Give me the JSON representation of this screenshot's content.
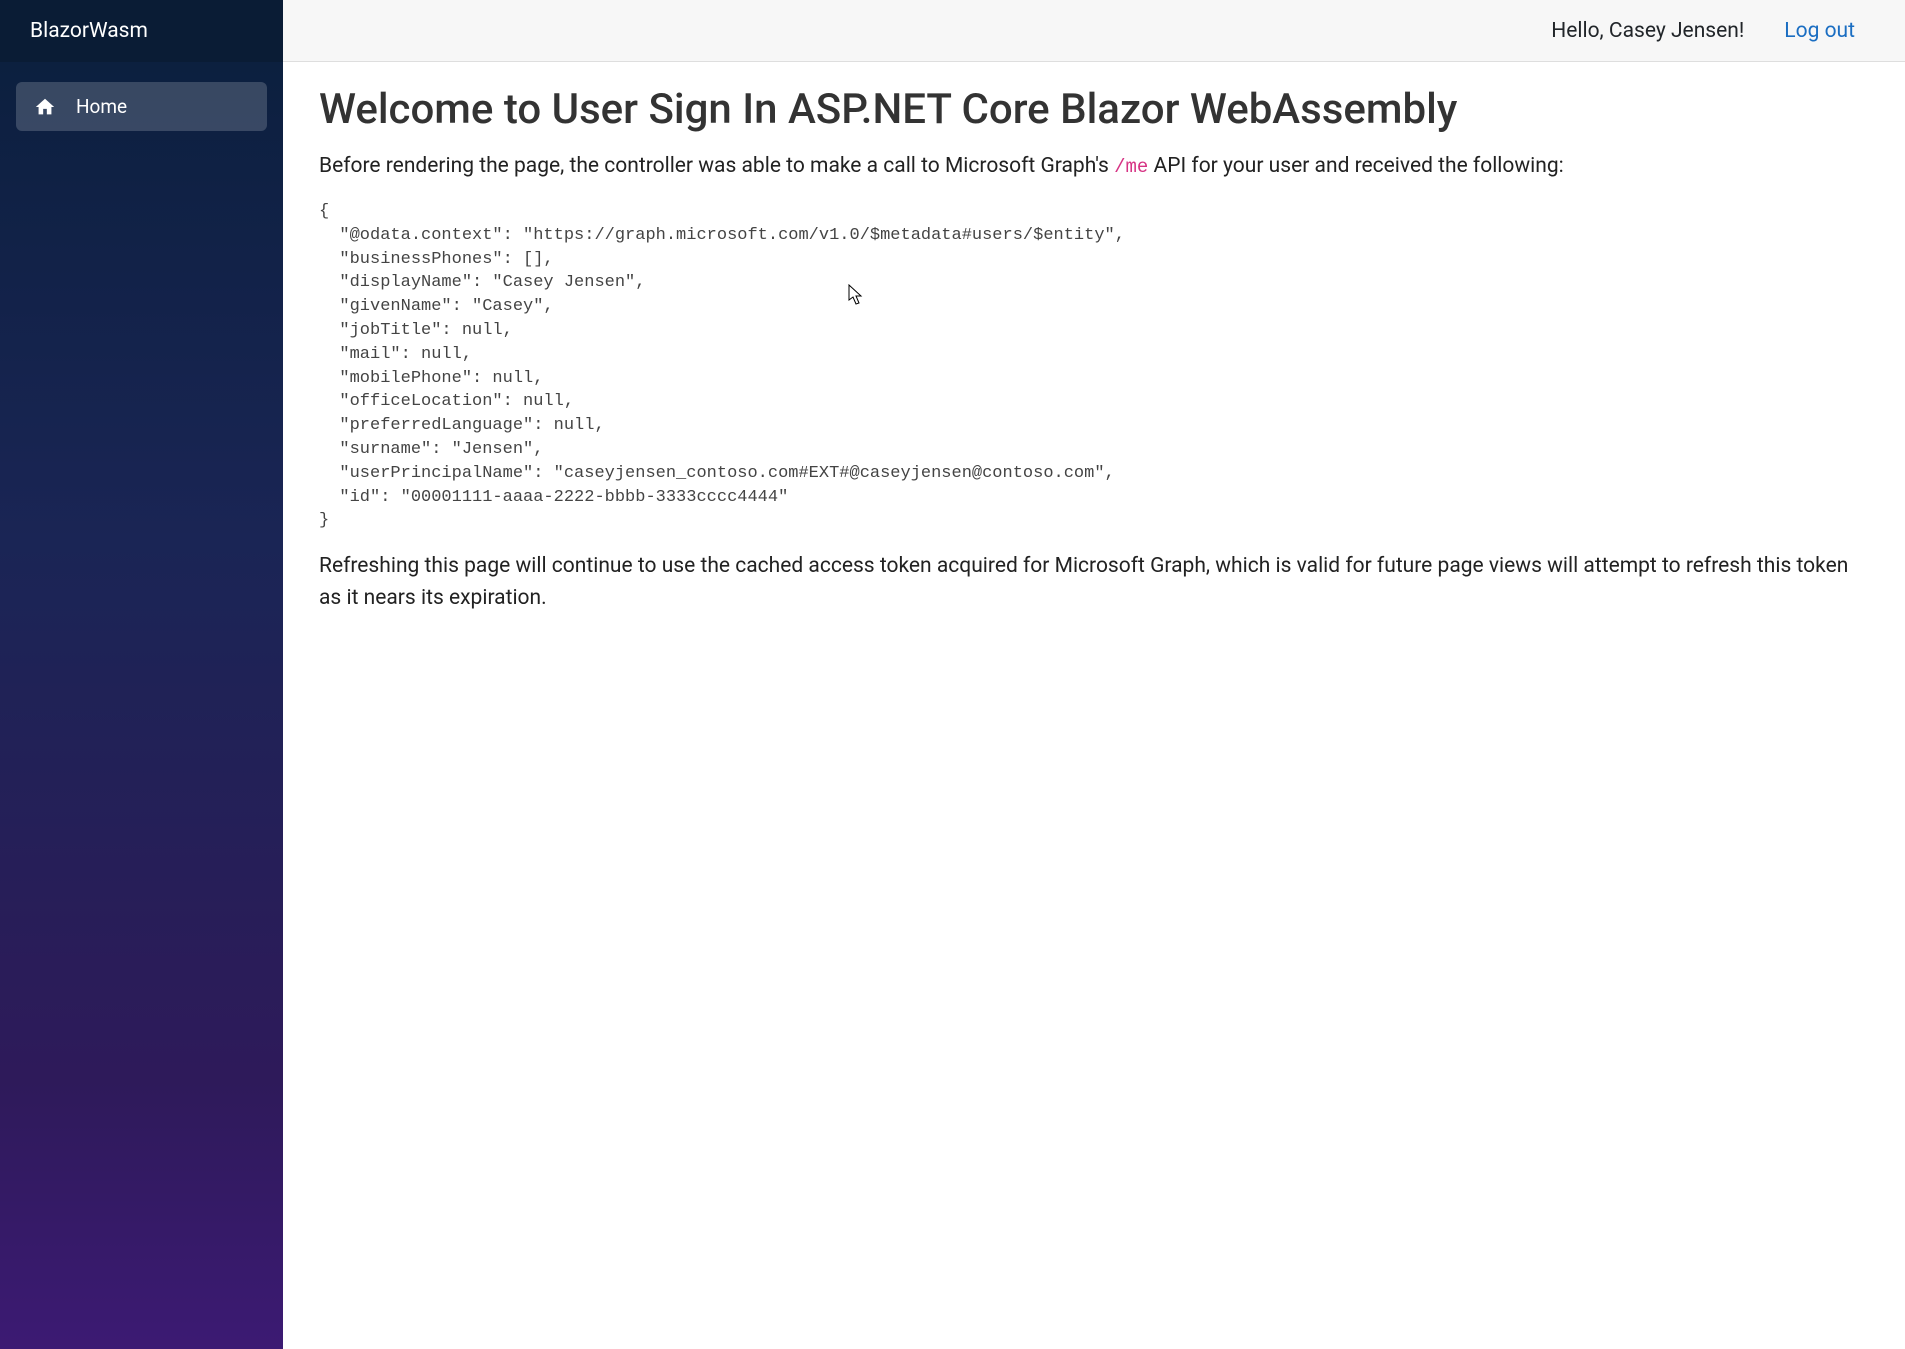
{
  "sidebar": {
    "brand": "BlazorWasm",
    "items": [
      {
        "label": "Home",
        "icon": "home-icon"
      }
    ]
  },
  "header": {
    "greeting": "Hello, Casey Jensen!",
    "logout_label": "Log out"
  },
  "main": {
    "title": "Welcome to User Sign In ASP.NET Core Blazor WebAssembly",
    "intro_before": "Before rendering the page, the controller was able to make a call to Microsoft Graph's ",
    "intro_code": "/me",
    "intro_after": " API for your user and received the following:",
    "json_output": "{\n  \"@odata.context\": \"https://graph.microsoft.com/v1.0/$metadata#users/$entity\",\n  \"businessPhones\": [],\n  \"displayName\": \"Casey Jensen\",\n  \"givenName\": \"Casey\",\n  \"jobTitle\": null,\n  \"mail\": null,\n  \"mobilePhone\": null,\n  \"officeLocation\": null,\n  \"preferredLanguage\": null,\n  \"surname\": \"Jensen\",\n  \"userPrincipalName\": \"caseyjensen_contoso.com#EXT#@caseyjensen@contoso.com\",\n  \"id\": \"00001111-aaaa-2222-bbbb-3333cccc4444\"\n}",
    "footer_text": "Refreshing this page will continue to use the cached access token acquired for Microsoft Graph, which is valid for future page views will attempt to refresh this token as it nears its expiration."
  }
}
